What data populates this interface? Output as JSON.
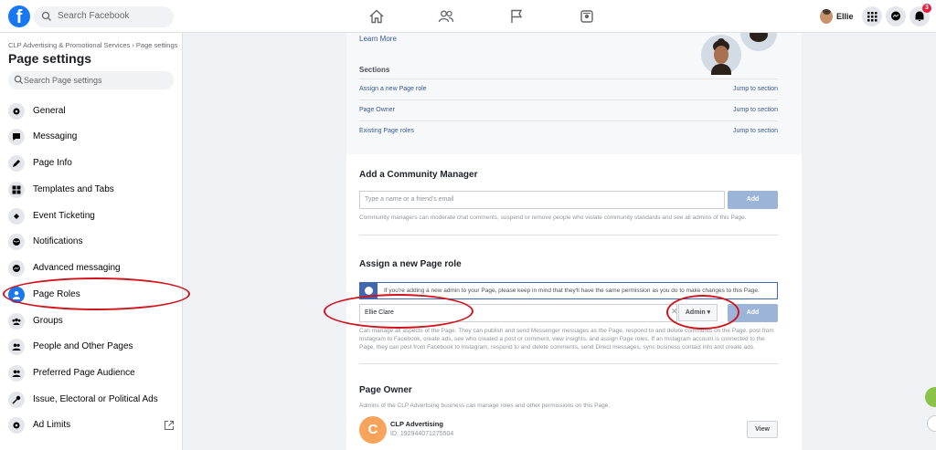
{
  "topbar": {
    "logo": "f",
    "search_placeholder": "Search Facebook",
    "user_name": "Ellie",
    "notification_count": "3"
  },
  "sidebar": {
    "breadcrumb": "CLP Advertising & Promotional Services › Page settings",
    "title": "Page settings",
    "search_placeholder": "Search Page settings",
    "items": [
      {
        "label": "General",
        "icon": "gear-icon"
      },
      {
        "label": "Messaging",
        "icon": "chat-icon"
      },
      {
        "label": "Page Info",
        "icon": "pencil-icon"
      },
      {
        "label": "Templates and Tabs",
        "icon": "grid-icon"
      },
      {
        "label": "Event Ticketing",
        "icon": "ticket-icon"
      },
      {
        "label": "Notifications",
        "icon": "globe-icon"
      },
      {
        "label": "Advanced messaging",
        "icon": "messenger-icon"
      },
      {
        "label": "Page Roles",
        "icon": "person-icon"
      },
      {
        "label": "Groups",
        "icon": "group-icon"
      },
      {
        "label": "People and Other Pages",
        "icon": "people-icon"
      },
      {
        "label": "Preferred Page Audience",
        "icon": "audience-icon"
      },
      {
        "label": "Issue, Electoral or Political Ads",
        "icon": "key-icon"
      },
      {
        "label": "Ad Limits",
        "icon": "gear-icon"
      }
    ]
  },
  "main": {
    "learn_more": "Learn More",
    "sections_heading": "Sections",
    "sections": [
      {
        "label": "Assign a new Page role",
        "jump": "Jump to section"
      },
      {
        "label": "Page Owner",
        "jump": "Jump to section"
      },
      {
        "label": "Existing Page roles",
        "jump": "Jump to section"
      }
    ],
    "community": {
      "heading": "Add a Community Manager",
      "placeholder": "Type a name or a friend's email",
      "add_label": "Add",
      "help": "Community managers can moderate chat comments, suspend or remove people who violate community standards and see all admins of this Page."
    },
    "assign": {
      "heading": "Assign a new Page role",
      "info": "If you're adding a new admin to your Page, please keep in mind that they'll have the same permission as you do to make changes to this Page.",
      "input_value": "Ellie Clare",
      "role": "Admin ▾",
      "add_label": "Add",
      "help": "Can manage all aspects of the Page. They can publish and send Messenger messages as the Page, respond to and delete comments on the Page, post from Instagram to Facebook, create ads, see who created a post or comment, view insights, and assign Page roles. If an Instagram account is connected to the Page, they can post from Facebook to Instagram, respond to and delete comments, send Direct messages, sync business contact info and create ads."
    },
    "owner": {
      "heading": "Page Owner",
      "desc": "Admins of the CLP Advertising business can manage roles and other permissions on this Page.",
      "initial": "C",
      "name": "CLP Advertising",
      "id": "ID: 192944071275504",
      "view_label": "View"
    }
  },
  "colors": {
    "brand": "#1877f2",
    "annotation": "#d0141b",
    "link": "#385898"
  }
}
